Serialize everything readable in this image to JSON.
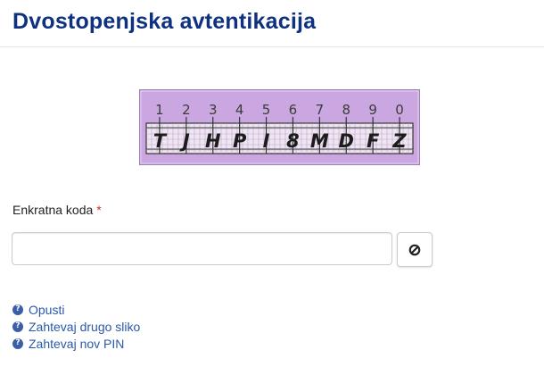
{
  "header": {
    "title": "Dvostopenjska avtentikacija"
  },
  "grid_card": {
    "columns": [
      "1",
      "2",
      "3",
      "4",
      "5",
      "6",
      "7",
      "8",
      "9",
      "0"
    ],
    "letters": [
      "T",
      "J",
      "H",
      "P",
      "I",
      "8",
      "M",
      "D",
      "F",
      "Z"
    ],
    "background": "#c9a6df"
  },
  "form": {
    "otp_label": "Enkratna koda",
    "required_mark": "*",
    "otp_value": "",
    "clear_icon": "ban-icon"
  },
  "links": [
    {
      "label": "Opusti",
      "icon": "question-circle-icon"
    },
    {
      "label": "Zahtevaj drugo sliko",
      "icon": "question-circle-icon"
    },
    {
      "label": "Zahtevaj nov PIN",
      "icon": "question-circle-icon"
    }
  ],
  "colors": {
    "title": "#0f3181",
    "link": "#2a5aa8",
    "required": "#c9302c"
  }
}
